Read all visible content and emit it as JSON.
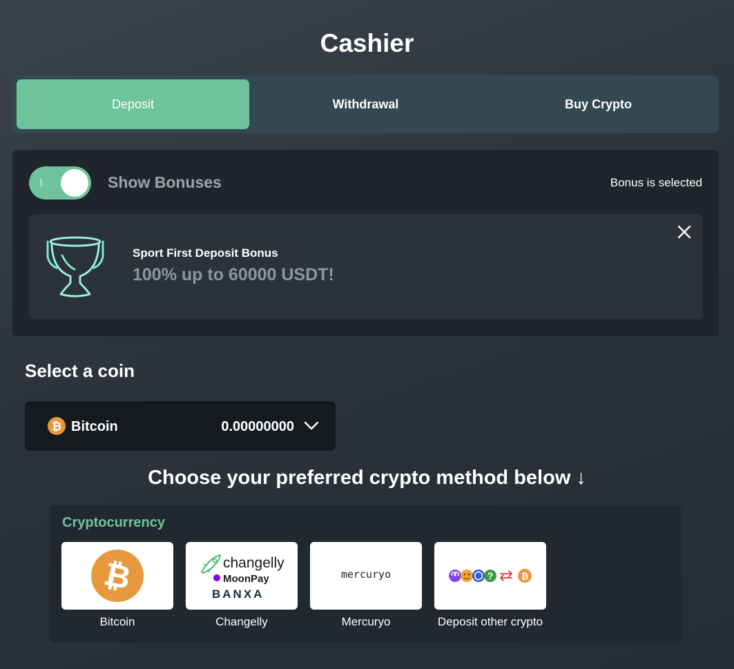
{
  "header": {
    "title": "Cashier"
  },
  "tabs": [
    {
      "label": "Deposit",
      "active": true
    },
    {
      "label": "Withdrawal",
      "active": false
    },
    {
      "label": "Buy Crypto",
      "active": false
    }
  ],
  "bonus": {
    "toggle_label": "Show Bonuses",
    "toggle_on": true,
    "status": "Bonus is selected",
    "name": "Sport First Deposit Bonus",
    "amount": "100% up to 60000 USDT!",
    "icon": "trophy-icon"
  },
  "coin_select": {
    "section_title": "Select a coin",
    "coin": "Bitcoin",
    "balance": "0.00000000",
    "icon": "bitcoin-icon"
  },
  "methods": {
    "heading": "Choose your preferred crypto method below ↓",
    "panel_title": "Cryptocurrency",
    "items": [
      {
        "label": "Bitcoin"
      },
      {
        "label": "Changelly",
        "logo_lines": [
          "changelly",
          "MoonPay",
          "BANXA"
        ]
      },
      {
        "label": "Mercuryo",
        "logo_text": "mercuryo"
      },
      {
        "label": "Deposit other crypto"
      }
    ]
  },
  "colors": {
    "accent": "#6fc39c",
    "tabs_bg": "#344851",
    "panel_bg": "#20252c",
    "card_bg": "#2c3239",
    "select_bg": "#161a1f",
    "bitcoin": "#e9983d"
  }
}
